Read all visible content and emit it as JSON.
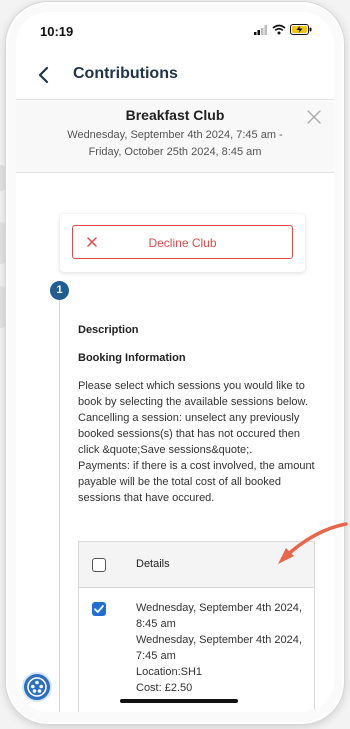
{
  "status_bar": {
    "time": "10:19"
  },
  "nav": {
    "title": "Contributions"
  },
  "club": {
    "title": "Breakfast Club",
    "dates": "Wednesday, September 4th 2024, 7:45 am - Friday, October 25th 2024, 8:45 am"
  },
  "decline": {
    "label": "Decline Club"
  },
  "step": {
    "number": "1"
  },
  "content": {
    "description_heading": "Description",
    "booking_heading": "Booking Information",
    "instructions": "Please select which sessions you would like to book by selecting the available sessions below.\nCancelling a session: unselect any previously booked sessions(s) that has not occured then click &quote;Save sessions&quote;.\nPayments: if there is a cost involved, the amount payable will be the total cost of all booked sessions that have occured."
  },
  "table": {
    "header": "Details",
    "header_checked": false,
    "rows": [
      {
        "checked": true,
        "details": "Wednesday, September 4th 2024, 8:45 am\nWednesday, September 4th 2024, 7:45 am\nLocation:SH1\nCost: £2.50"
      }
    ]
  },
  "colors": {
    "accent": "#1f5d92",
    "decline_red": "#df4b4b",
    "checkbox_blue": "#1f6fd1",
    "annotation_arrow": "#e8674a"
  },
  "icons": {
    "back": "chevron-left-icon",
    "close": "close-icon",
    "decline": "close-icon",
    "fab": "accessibility-icon"
  }
}
